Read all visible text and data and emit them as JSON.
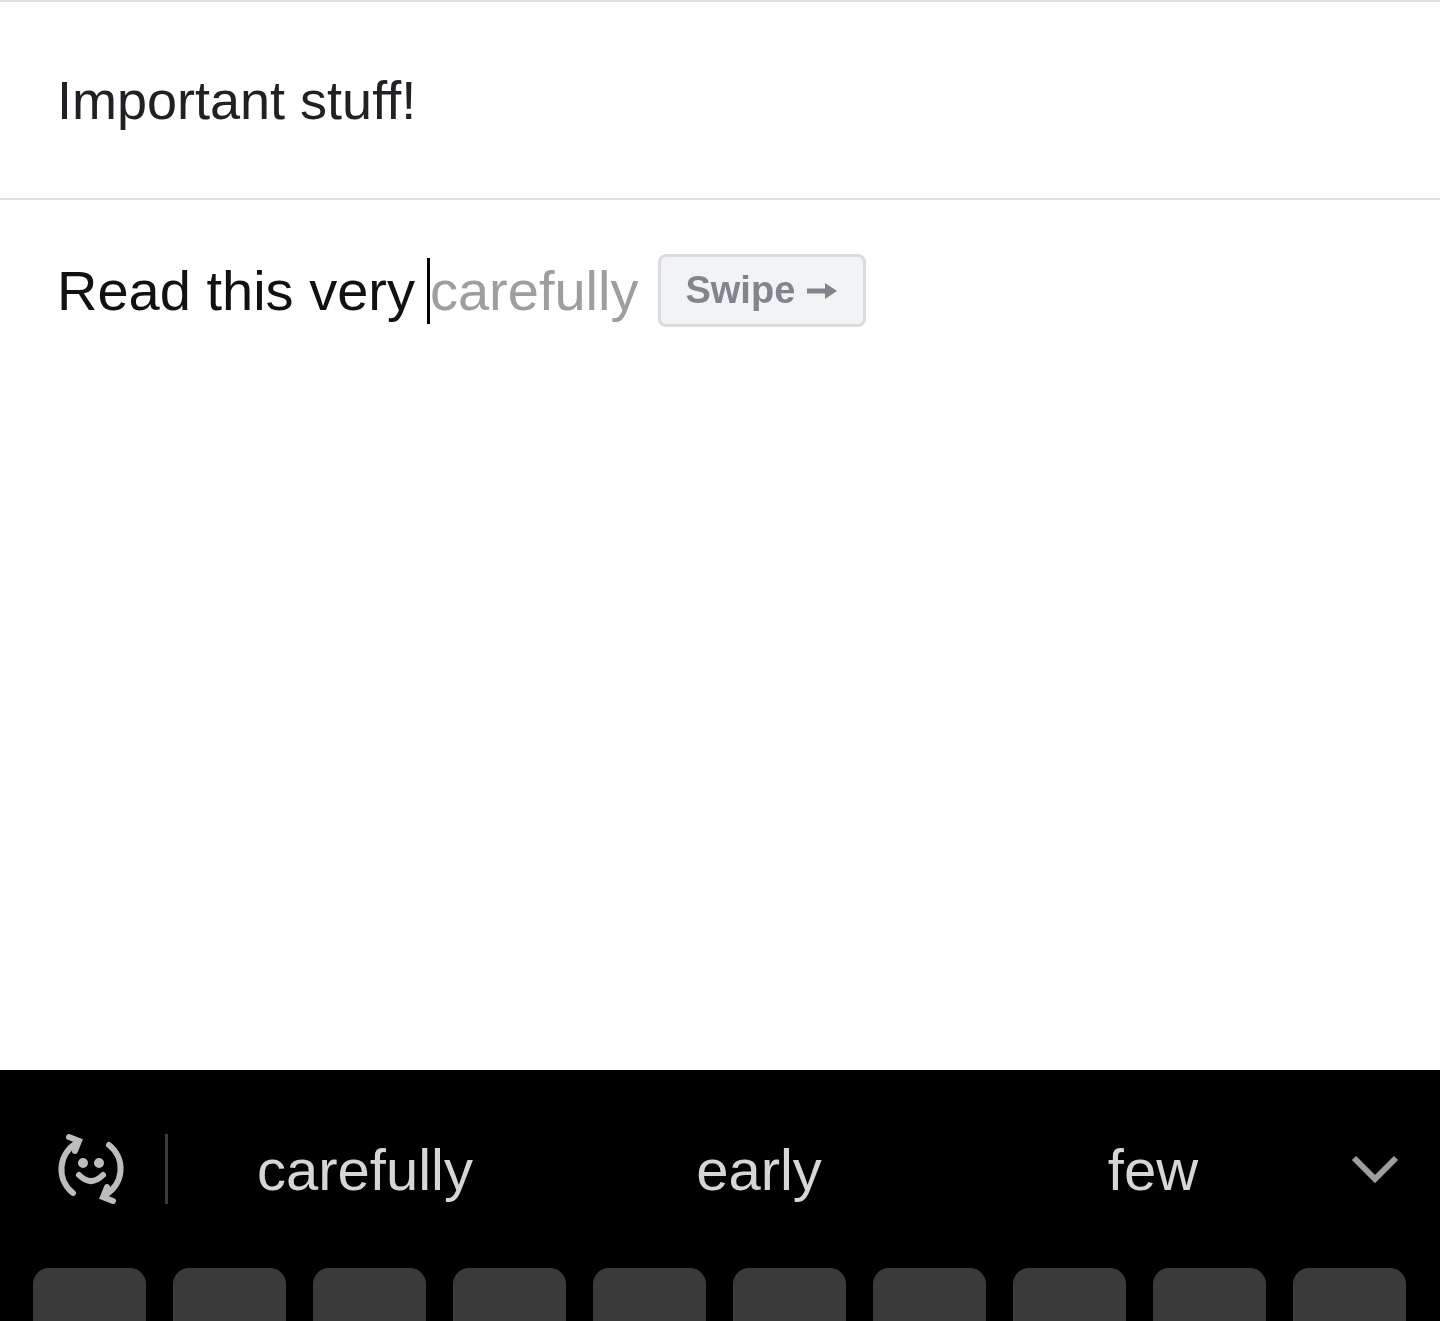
{
  "subject": {
    "value": "Important stuff!"
  },
  "body": {
    "value": "Read this very",
    "suggestion": "carefully",
    "hint": "Swipe"
  },
  "keyboard": {
    "suggestions": [
      "carefully",
      "early",
      "few"
    ]
  }
}
